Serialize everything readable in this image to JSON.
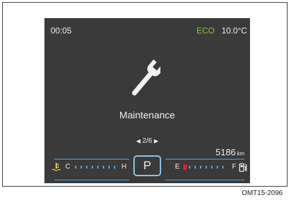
{
  "status_bar": {
    "clock": "00:05",
    "eco_label": "ECO",
    "temperature": "10.0°C"
  },
  "message": {
    "title": "Maintenance",
    "page_indicator": "2/6",
    "left_arrow": "◀",
    "right_arrow": "▶"
  },
  "odometer": {
    "value": "5186",
    "unit": "km"
  },
  "gear": {
    "position": "P"
  },
  "coolant_gauge": {
    "low_label": "C",
    "high_label": "H",
    "icon": "coolant-temperature-icon"
  },
  "fuel_gauge": {
    "empty_label": "E",
    "full_label": "F",
    "icon": "fuel-pump-icon",
    "level": 0.12
  },
  "caption": {
    "code": "OMT15-2096"
  },
  "colors": {
    "screen": "#3a3a3a",
    "eco": "#8dc63f",
    "accent": "#5aa0d8",
    "warning": "#e0212b"
  }
}
